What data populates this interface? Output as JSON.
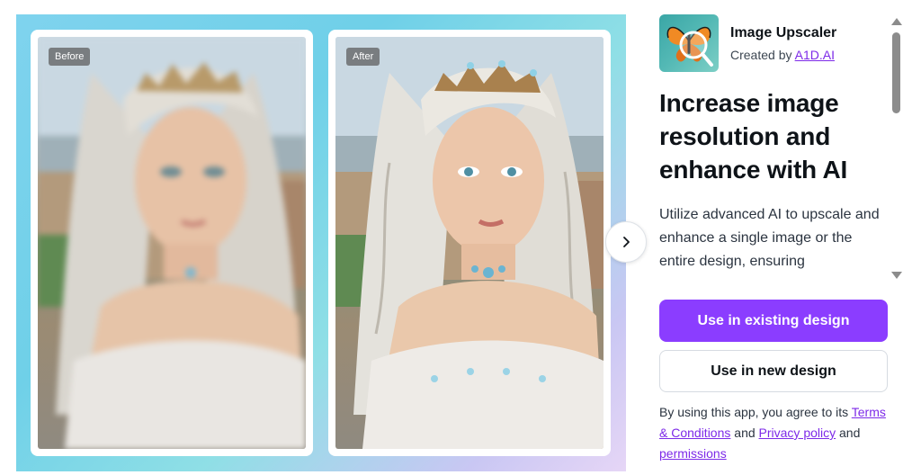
{
  "preview": {
    "before_label": "Before",
    "after_label": "After",
    "next_icon": "chevron-right-icon"
  },
  "app": {
    "icon": "butterfly-magnifier-icon",
    "name": "Image Upscaler",
    "created_by_prefix": "Created by",
    "author": "A1D.AI"
  },
  "content": {
    "headline": "Increase image resolution and enhance with AI",
    "description": "Utilize advanced AI to upscale and enhance a single image or the entire design, ensuring"
  },
  "actions": {
    "primary_label": "Use in existing design",
    "secondary_label": "Use in new design"
  },
  "terms": {
    "prefix": "By using this app, you agree to its",
    "terms_link": "Terms & Conditions",
    "and_1": "and",
    "privacy_link": "Privacy policy",
    "and_2": "and",
    "permissions_link": "permissions"
  },
  "colors": {
    "accent": "#8b3dff",
    "link": "#7d2ae8",
    "panel_gradient_start": "#7fd3ee",
    "panel_gradient_end": "#e6d6f6"
  }
}
